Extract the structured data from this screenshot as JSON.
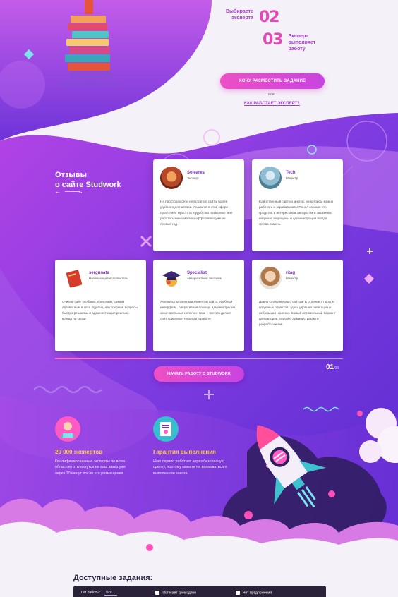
{
  "steps": [
    {
      "num": "02",
      "text": "Выбираете\nэксперта"
    },
    {
      "num": "03",
      "text": "Эксперт\nвыполняет\nработу"
    }
  ],
  "cta_top": "ХОЧУ РАЗМЕСТИТЬ ЗАДАНИЕ",
  "or_text": "или",
  "how_link": "КАК РАБОТАЕТ ЭКСПЕРТ?",
  "reviews": {
    "title_line1": "Отзывы",
    "title_line2": "о сайте Studwork",
    "prev_icon": "arrow-left-icon",
    "next_icon": "arrow-right-icon",
    "cards": [
      {
        "name": "Soleares",
        "role": "Эксперт",
        "text": "На просторах сети не встретил сайта, более удобного для автора. Аналогов в этой сфере просто нет. Простота и удобство позволяют мне работать максимально эффективно уже не первый год."
      },
      {
        "name": "Tech",
        "role": "Магистр",
        "text": "Единственный сайт из многих, на котором можно работать и зарабатывать! Понял хорошо что средства и интересы как автора так и заказчика надежно защищены и администрация всегда готова помочь."
      },
      {
        "name": "sergunata",
        "role": "Начинающий исполнитель",
        "text": "Считаю сайт удобным, понятным, самым адекватным в сети. Удобно, что спорные вопросы быстро решаемы и администрация реально всегда на связи."
      },
      {
        "name": "Specialist",
        "role": "Авторитетный заказчик",
        "text": "Являюсь постоянным клиентом сайта. Удобный интерфейс, оперативная помощь администрации, замечательные исполни- тели – все это делает сайт привлека- тельным в работе"
      },
      {
        "name": "ritag",
        "role": "Магистр",
        "text": "Давно сотрудничаю с сайтом. В отличие от других подобных проектов, здесь удобная навигация и небольшая наценка. Самый оптимальный вариант для авторов, спасибо администрации и разработчикам!"
      }
    ],
    "pager_current": "01",
    "pager_total": "/03",
    "progress": 0.33
  },
  "cta_mid": "НАЧАТЬ РАБОТУ С STUDWORK",
  "features": [
    {
      "title": "20 000 экспертов",
      "icon": "expert-icon",
      "text": "Квалифицированные эксперты по всем областям откликнутся на ваш заказ уже через 10 минут после его размещения."
    },
    {
      "title": "Гарантия выполнения",
      "icon": "guarantee-certificate-icon",
      "text": "Наш сервис работает через безопасную сделку, поэтому можете не волноваться о выполнении заказа."
    }
  ],
  "tasks": {
    "title": "Доступные задания:",
    "filter_label": "Тип работы:",
    "filter_value": "Все",
    "check1": "Истекает срок сдачи",
    "check2": "Нет предложений"
  },
  "colors": {
    "accent": "#e24bb5",
    "purple": "#7b2fd6",
    "yellow": "#ffd23f"
  }
}
